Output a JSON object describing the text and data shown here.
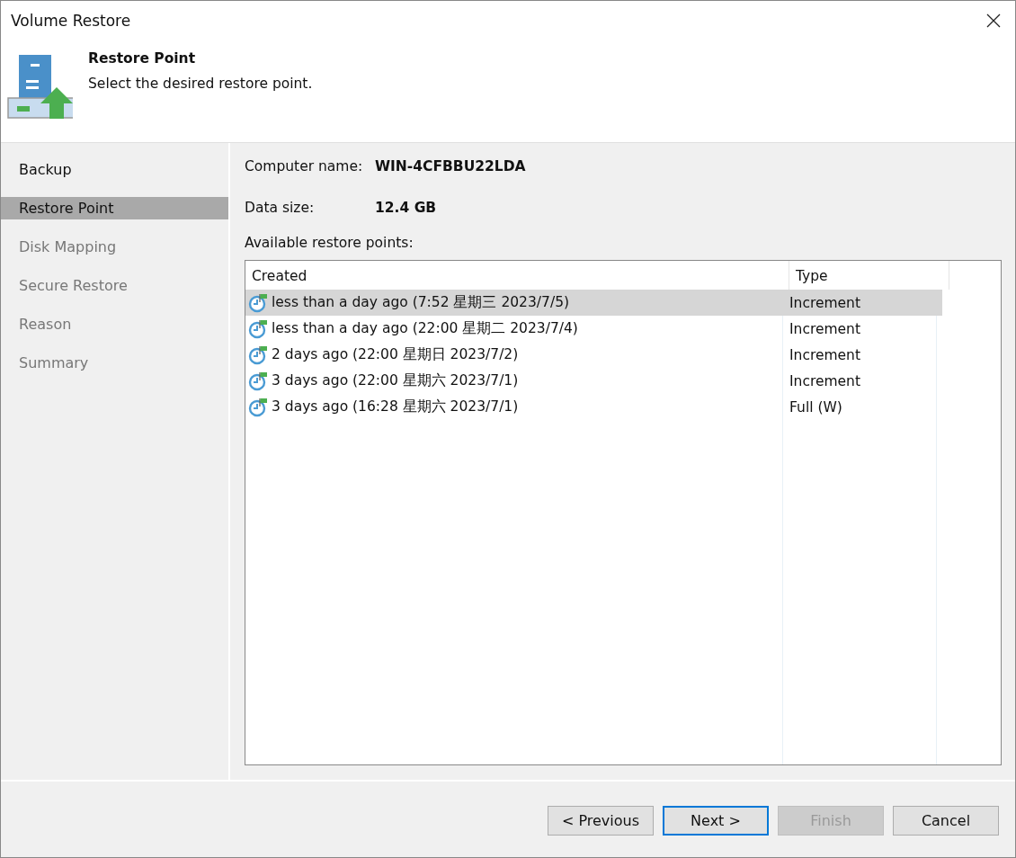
{
  "window": {
    "title": "Volume Restore"
  },
  "header": {
    "title": "Restore Point",
    "subtitle": "Select the desired restore point."
  },
  "sidebar": {
    "items": [
      {
        "label": "Backup",
        "selected": false,
        "disabled": false
      },
      {
        "label": "Restore Point",
        "selected": true,
        "disabled": false
      },
      {
        "label": "Disk Mapping",
        "selected": false,
        "disabled": true
      },
      {
        "label": "Secure Restore",
        "selected": false,
        "disabled": true
      },
      {
        "label": "Reason",
        "selected": false,
        "disabled": true
      },
      {
        "label": "Summary",
        "selected": false,
        "disabled": true
      }
    ]
  },
  "info": [
    {
      "label": "Computer name:",
      "value": "WIN-4CFBBU22LDA"
    },
    {
      "label": "Data size:",
      "value": "12.4 GB"
    }
  ],
  "restore_points": {
    "label": "Available restore points:",
    "columns": [
      "Created",
      "Type"
    ],
    "rows": [
      {
        "created": "less than a day ago (7:52 星期三 2023/7/5)",
        "type": "Increment",
        "selected": true
      },
      {
        "created": "less than a day ago (22:00 星期二 2023/7/4)",
        "type": "Increment",
        "selected": false
      },
      {
        "created": "2 days ago (22:00 星期日 2023/7/2)",
        "type": "Increment",
        "selected": false
      },
      {
        "created": "3 days ago (22:00 星期六 2023/7/1)",
        "type": "Increment",
        "selected": false
      },
      {
        "created": "3 days ago (16:28 星期六 2023/7/1)",
        "type": "Full (W)",
        "selected": false
      }
    ]
  },
  "buttons": [
    {
      "label": "< Previous",
      "disabled": false,
      "focused": false
    },
    {
      "label": "Next >",
      "disabled": false,
      "focused": true
    },
    {
      "label": "Finish",
      "disabled": true,
      "focused": false
    },
    {
      "label": "Cancel",
      "disabled": false,
      "focused": false
    }
  ]
}
